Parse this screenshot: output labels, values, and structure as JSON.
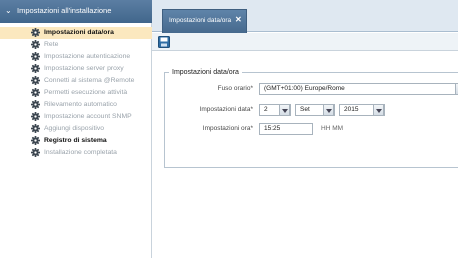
{
  "nav": {
    "title": "Impostazioni all'installazione",
    "items": [
      {
        "label": "Impostazioni data/ora",
        "selected": true,
        "active": true
      },
      {
        "label": "Rete"
      },
      {
        "label": "Impostazione autenticazione"
      },
      {
        "label": "Impostazione server proxy"
      },
      {
        "label": "Connetti al sistema @Remote"
      },
      {
        "label": "Permetti esecuzione attività"
      },
      {
        "label": "Rilevamento automatico"
      },
      {
        "label": "Impostazione account SNMP"
      },
      {
        "label": "Aggiungi dispositivo"
      },
      {
        "label": "Registro di sistema",
        "active": true
      },
      {
        "label": "Installazione completata"
      }
    ]
  },
  "tab": {
    "label": "Impostazioni data/ora",
    "close": "✕"
  },
  "form": {
    "legend": "Impostazioni data/ora",
    "timezone_label": "Fuso orario*",
    "timezone_value": "(GMT+01:00) Europe/Rome",
    "date_label": "Impostazioni data*",
    "day": "2",
    "month": "Set",
    "year": "2015",
    "time_label": "Impostazioni ora*",
    "time_value": "15:25",
    "time_format": "HH MM"
  },
  "colors": {
    "header_bg": "#41668c",
    "selected_bg": "#fbe8bf",
    "gear_color": "#3c4650"
  }
}
